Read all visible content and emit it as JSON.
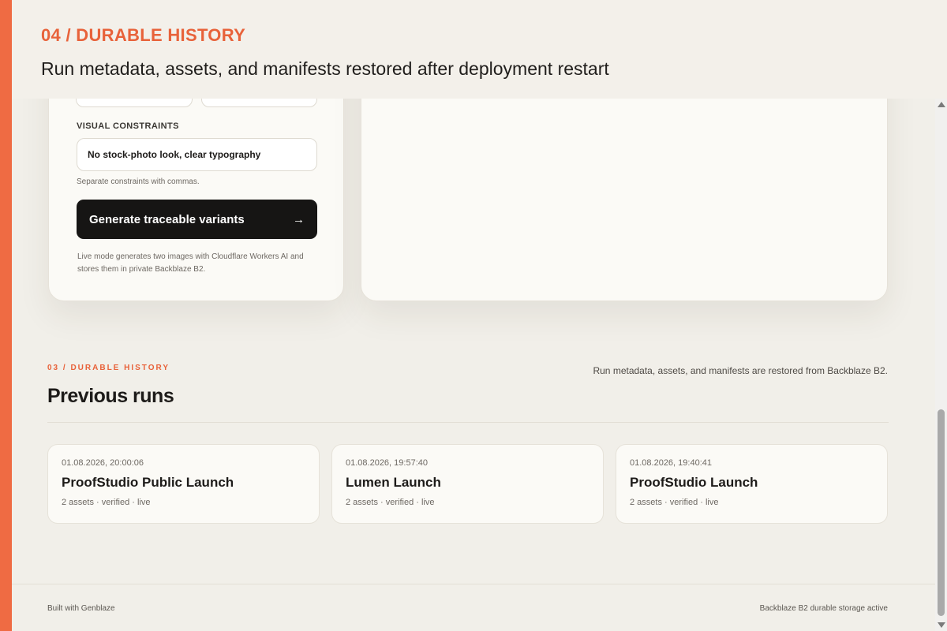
{
  "overlay": {
    "kicker": "04 / DURABLE HISTORY",
    "title": "Run metadata, assets, and manifests restored after deployment restart"
  },
  "form": {
    "visual_label": "VISUAL CONSTRAINTS",
    "visual_value": "No stock-photo look, clear typography",
    "helper": "Separate constraints with commas.",
    "generate_label": "Generate traceable variants",
    "generate_arrow": "→",
    "note": "Live mode generates two images with Cloudflare Workers AI and stores them in private Backblaze B2."
  },
  "history": {
    "kicker": "03 / DURABLE HISTORY",
    "title": "Previous runs",
    "description": "Run metadata, assets, and manifests are restored from Backblaze B2.",
    "runs": [
      {
        "date": "01.08.2026, 20:00:06",
        "name": "ProofStudio Public Launch",
        "meta": "2 assets · verified · live"
      },
      {
        "date": "01.08.2026, 19:57:40",
        "name": "Lumen Launch",
        "meta": "2 assets · verified · live"
      },
      {
        "date": "01.08.2026, 19:40:41",
        "name": "ProofStudio Launch",
        "meta": "2 assets · verified · live"
      }
    ]
  },
  "footer": {
    "left": "Built with Genblaze",
    "right": "Backblaze B2 durable storage active"
  },
  "colors": {
    "accent": "#ef6b43",
    "background": "#f1efe9",
    "card": "#fbfaf6",
    "button": "#161514"
  }
}
